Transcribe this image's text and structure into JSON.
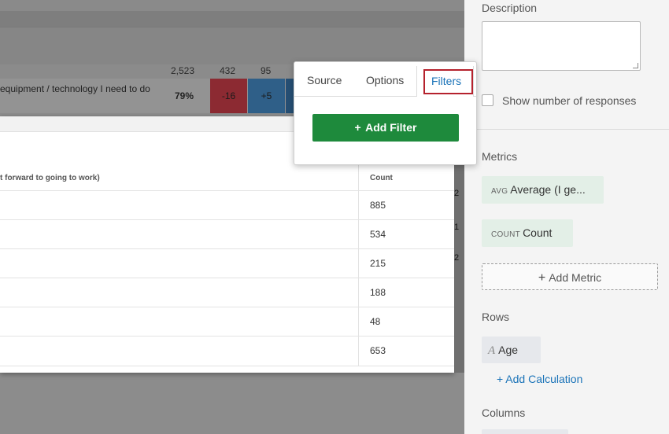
{
  "background_table": {
    "header_numbers": [
      "2,523",
      "432",
      "95"
    ],
    "row_text": "equipment / technology I need to do",
    "row_percent": "79%",
    "heat_values": [
      "-16",
      "+5"
    ]
  },
  "table_card": {
    "column_header": "t forward to going to work)",
    "count_header": "Count",
    "counts": [
      "885",
      "534",
      "215",
      "188",
      "48",
      "653"
    ],
    "right_edge_marks": [
      "2",
      "1",
      "2"
    ]
  },
  "popover": {
    "tabs": [
      "Source",
      "Options",
      "Filters"
    ],
    "active_tab": "Filters",
    "add_filter_label": "Add Filter"
  },
  "panel": {
    "description_label": "Description",
    "description_value": "",
    "show_responses_label": "Show number of responses",
    "show_responses_checked": false,
    "metrics_label": "Metrics",
    "metrics": [
      {
        "tag": "AVG",
        "label": "Average (I ge..."
      },
      {
        "tag": "COUNT",
        "label": "Count"
      }
    ],
    "add_metric_label": "Add Metric",
    "rows_label": "Rows",
    "row_item": "Age",
    "add_calculation_label": "+ Add Calculation",
    "columns_label": "Columns"
  },
  "colors": {
    "accent_blue": "#1a73b8",
    "add_filter_green": "#1e8a3c",
    "highlight_red": "#b5222d",
    "heat_red": "#8c2a32",
    "heat_blue": "#2f5f88"
  }
}
